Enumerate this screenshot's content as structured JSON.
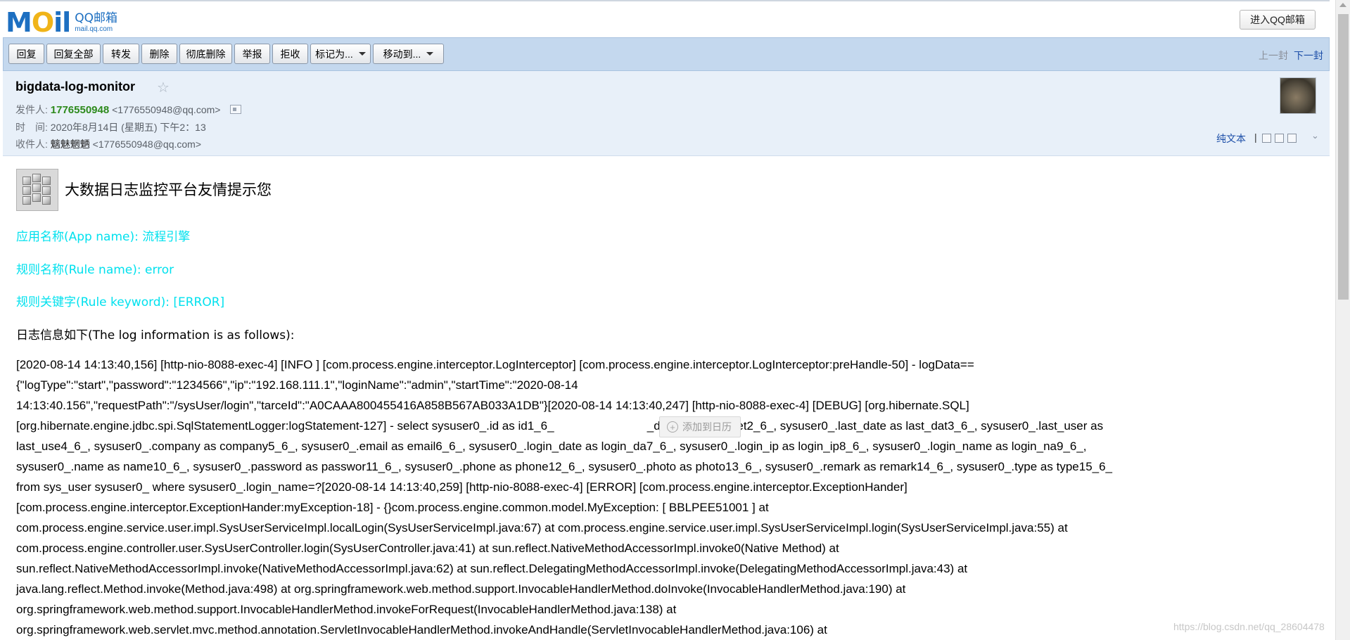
{
  "header": {
    "logo_mail": "MOil",
    "logo_cn": "QQ邮箱",
    "logo_url": "mail.qq.com",
    "enter_button": "进入QQ邮箱"
  },
  "toolbar": {
    "buttons": [
      "回复",
      "回复全部",
      "转发",
      "删除",
      "彻底删除",
      "举报",
      "拒收"
    ],
    "dropdowns": [
      "标记为...",
      "移动到..."
    ],
    "prev": "上一封",
    "next": "下一封"
  },
  "mail": {
    "subject": "bigdata-log-monitor",
    "star": "☆",
    "sender_label": "发件人:",
    "sender_name": "1776550948",
    "sender_addr": "<1776550948@qq.com>",
    "time_label": "时　间:",
    "time_value": "2020年8月14日 (星期五) 下午2：13",
    "recipient_label": "收件人:",
    "recipient_name": "魑魅魍魉",
    "recipient_addr": "<1776550948@qq.com>",
    "plain_text": "纯文本",
    "separator": "|",
    "chevron": "⌄"
  },
  "content": {
    "title": "大数据日志监控平台友情提示您",
    "app_name": "应用名称(App name): 流程引擎",
    "rule_name": "规则名称(Rule name): error",
    "rule_keyword": "规则关键字(Rule keyword): [ERROR]",
    "log_intro": "日志信息如下(The log information is as follows):",
    "log_lines": [
      "[2020-08-14 14:13:40,156] [http-nio-8088-exec-4] [INFO ] [com.process.engine.interceptor.LogInterceptor] [com.process.engine.interceptor.LogInterceptor:preHandle-50] - logData==",
      "{\"logType\":\"start\",\"password\":\"1234566\",\"ip\":\"192.168.111.1\",\"loginName\":\"admin\",\"startTime\":\"2020-08-14",
      "14:13:40.156\",\"requestPath\":\"/sysUser/login\",\"tarceId\":\"A0CAAA800455416A858B567AB033A1DB\"}[2020-08-14 14:13:40,247] [http-nio-8088-exec-4] [DEBUG] [org.hibernate.SQL]",
      "[org.hibernate.engine.jdbc.spi.SqlStatementLogger:logStatement-127] - select sysuser0_.id as id1_6_                            _delete as is_delet2_6_, sysuser0_.last_date as last_dat3_6_, sysuser0_.last_user as",
      "last_use4_6_, sysuser0_.company as company5_6_, sysuser0_.email as email6_6_, sysuser0_.login_date as login_da7_6_, sysuser0_.login_ip as login_ip8_6_, sysuser0_.login_name as login_na9_6_,",
      "sysuser0_.name as name10_6_, sysuser0_.password as passwor11_6_, sysuser0_.phone as phone12_6_, sysuser0_.photo as photo13_6_, sysuser0_.remark as remark14_6_, sysuser0_.type as type15_6_",
      "from sys_user sysuser0_ where sysuser0_.login_name=?[2020-08-14 14:13:40,259] [http-nio-8088-exec-4] [ERROR] [com.process.engine.interceptor.ExceptionHander]",
      "[com.process.engine.interceptor.ExceptionHander:myException-18] - {}com.process.engine.common.model.MyException: [ BBLPEE51001 ] at",
      "com.process.engine.service.user.impl.SysUserServiceImpl.localLogin(SysUserServiceImpl.java:67) at com.process.engine.service.user.impl.SysUserServiceImpl.login(SysUserServiceImpl.java:55) at",
      "com.process.engine.controller.user.SysUserController.login(SysUserController.java:41) at sun.reflect.NativeMethodAccessorImpl.invoke0(Native Method) at",
      "sun.reflect.NativeMethodAccessorImpl.invoke(NativeMethodAccessorImpl.java:62) at sun.reflect.DelegatingMethodAccessorImpl.invoke(DelegatingMethodAccessorImpl.java:43) at",
      "java.lang.reflect.Method.invoke(Method.java:498) at org.springframework.web.method.support.InvocableHandlerMethod.doInvoke(InvocableHandlerMethod.java:190) at",
      "org.springframework.web.method.support.InvocableHandlerMethod.invokeForRequest(InvocableHandlerMethod.java:138) at",
      "org.springframework.web.servlet.mvc.method.annotation.ServletInvocableHandlerMethod.invokeAndHandle(ServletInvocableHandlerMethod.java:106) at"
    ],
    "calendar_chip": "添加到日历",
    "watermark": "https://blog.csdn.net/qq_28604478"
  },
  "colors": {
    "toolbar_bg": "#c4d8ee",
    "header_bg": "#e8f0f9",
    "sender_green": "#2d8a1c",
    "link_blue": "#1c4ea8",
    "cyan_text": "#00e1ee"
  }
}
